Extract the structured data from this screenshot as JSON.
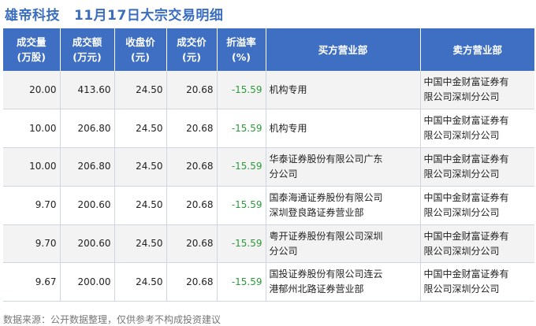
{
  "title": {
    "stock_name": "雄帝科技",
    "subtitle": "11月17日大宗交易明细"
  },
  "table": {
    "headers": [
      [
        "成交量",
        "(万股)"
      ],
      [
        "成交额",
        "(万元)"
      ],
      [
        "收盘价",
        "(元)"
      ],
      [
        "成交价",
        "(元)"
      ],
      [
        "折溢率",
        "(%)"
      ],
      [
        "买方营业部",
        ""
      ],
      [
        "卖方营业部",
        ""
      ]
    ],
    "rows": [
      {
        "volume": "20.00",
        "amount": "413.60",
        "close": "24.50",
        "price": "20.68",
        "premium": "-15.59",
        "buyer": [
          "机构专用"
        ],
        "seller": [
          "中国中金财富证券有",
          "限公司深圳分公司"
        ]
      },
      {
        "volume": "10.00",
        "amount": "206.80",
        "close": "24.50",
        "price": "20.68",
        "premium": "-15.59",
        "buyer": [
          "机构专用"
        ],
        "seller": [
          "中国中金财富证券有",
          "限公司深圳分公司"
        ]
      },
      {
        "volume": "10.00",
        "amount": "206.80",
        "close": "24.50",
        "price": "20.68",
        "premium": "-15.59",
        "buyer": [
          "华泰证券股份有限公司广东",
          "分公司"
        ],
        "seller": [
          "中国中金财富证券有",
          "限公司深圳分公司"
        ]
      },
      {
        "volume": "9.70",
        "amount": "200.60",
        "close": "24.50",
        "price": "20.68",
        "premium": "-15.59",
        "buyer": [
          "国泰海通证券股份有限公司",
          "深圳登良路证券营业部"
        ],
        "seller": [
          "中国中金财富证券有",
          "限公司深圳分公司"
        ]
      },
      {
        "volume": "9.70",
        "amount": "200.60",
        "close": "24.50",
        "price": "20.68",
        "premium": "-15.59",
        "buyer": [
          "粤开证券股份有限公司深圳",
          "分公司"
        ],
        "seller": [
          "中国中金财富证券有",
          "限公司深圳分公司"
        ]
      },
      {
        "volume": "9.67",
        "amount": "200.00",
        "close": "24.50",
        "price": "20.68",
        "premium": "-15.59",
        "buyer": [
          "国投证券股份有限公司连云",
          "港郁州北路证券营业部"
        ],
        "seller": [
          "中国中金财富证券有",
          "限公司深圳分公司"
        ]
      }
    ]
  },
  "footer": {
    "source_text": "数据来源：公开数据整理，仅供参考不构成投资建议"
  },
  "colors": {
    "title": "#3a6dbf",
    "header_bg": "#3f6fc2",
    "negative": "#2a9a3a"
  }
}
